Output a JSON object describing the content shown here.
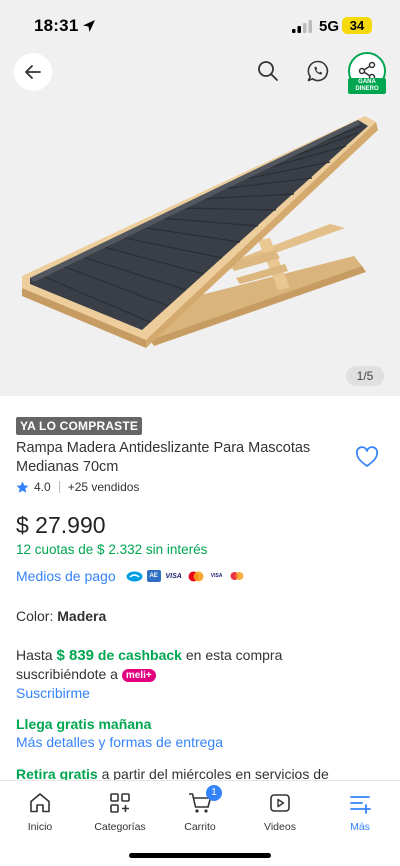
{
  "status_bar": {
    "time": "18:31",
    "network": "5G",
    "battery": "34"
  },
  "header": {
    "earn_badge": "GANA DINERO"
  },
  "gallery": {
    "counter": "1/5"
  },
  "product": {
    "badge": "YA LO COMPRASTE",
    "title": "Rampa  Madera Antideslizante Para Mascotas Medianas 70cm",
    "rating": "4.0",
    "sold": "+25 vendidos",
    "price": "$ 27.990",
    "installments": "12 cuotas de $ 2.332 sin interés",
    "payment_link": "Medios de pago",
    "payment_icons": [
      "mercadopago-icon",
      "amex-icon",
      "visa-icon",
      "mastercard-icon",
      "visa-debit-icon",
      "maestro-icon"
    ],
    "color_label": "Color:",
    "color_value": "Madera",
    "cashback_prefix": "Hasta",
    "cashback_amount": "$ 839",
    "cashback_word": "de cashback",
    "cashback_suffix": "en esta compra suscribiéndote a",
    "meli_badge": "meli+",
    "subscribe_link": "Suscribirme",
    "shipping": "Llega gratis mañana",
    "shipping_link": "Más detalles y formas de entrega",
    "pickup_green": "Retira gratis",
    "pickup_text": "a partir del miércoles en servicios de"
  },
  "nav": {
    "items": [
      {
        "label": "Inicio"
      },
      {
        "label": "Categorías"
      },
      {
        "label": "Carrito",
        "badge": "1"
      },
      {
        "label": "Videos"
      },
      {
        "label": "Más"
      }
    ]
  },
  "colors": {
    "accent_blue": "#3483fa",
    "green": "#00a650",
    "battery": "#f5d90a"
  }
}
